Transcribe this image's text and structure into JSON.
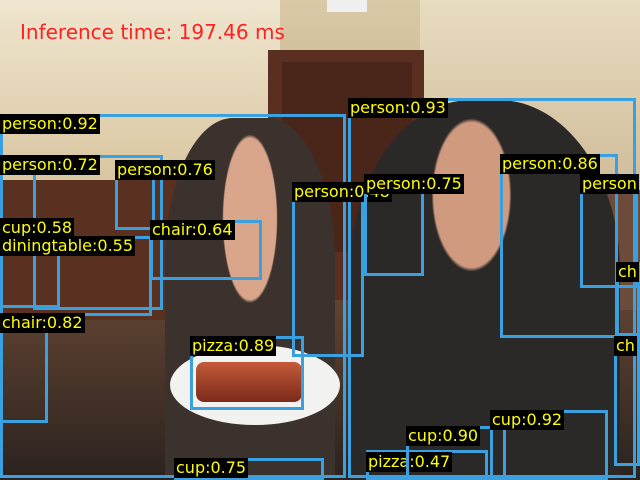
{
  "inference_text": "Inference time: 197.46 ms",
  "box_color": "#3aa0e0",
  "label_text_color": "#ffff00",
  "label_bg_color": "#000000",
  "detections": [
    {
      "label": "person:0.92"
    },
    {
      "label": "person:0.93"
    },
    {
      "label": "person:0.72"
    },
    {
      "label": "person:0.76"
    },
    {
      "label": "person:0.48"
    },
    {
      "label": "person:0.75"
    },
    {
      "label": "person:0.86"
    },
    {
      "label": "person"
    },
    {
      "label": "cup:0.58"
    },
    {
      "label": "diningtable:0.55"
    },
    {
      "label": "chair:0.64"
    },
    {
      "label": "chair:0.82"
    },
    {
      "label": "pizza:0.89"
    },
    {
      "label": "cup:0.75"
    },
    {
      "label": "pizza:0.47"
    },
    {
      "label": "cup:0.90"
    },
    {
      "label": "cup:0.92"
    },
    {
      "label": "ch"
    },
    {
      "label": "ch"
    }
  ]
}
